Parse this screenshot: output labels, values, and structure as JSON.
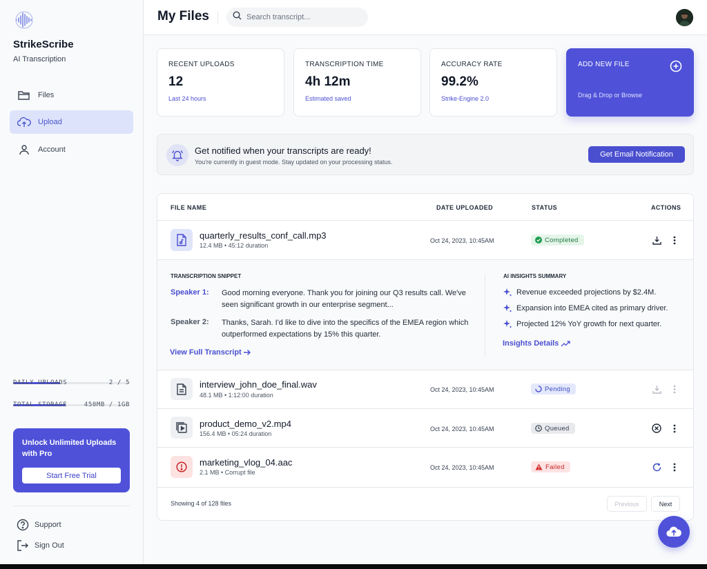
{
  "brand": {
    "name": "StrikeScribe",
    "tagline": "AI Transcription"
  },
  "nav": [
    {
      "label": "Files",
      "icon": "folder-icon",
      "active": false
    },
    {
      "label": "Upload",
      "icon": "cloud-upload-icon",
      "active": true
    },
    {
      "label": "Account",
      "icon": "user-icon",
      "active": false
    }
  ],
  "usage": {
    "daily_uploads": {
      "label": "DAILY UPLOADS",
      "value": "2 / 5",
      "fraction": 0.4
    },
    "total_storage": {
      "label": "TOTAL STORAGE",
      "value": "450MB / 1GB",
      "fraction": 0.45
    }
  },
  "promo": {
    "title": "Unlock Unlimited Uploads with Pro",
    "button": "Start Free Trial"
  },
  "footer_links": {
    "support": "Support",
    "signout": "Sign Out"
  },
  "header": {
    "title": "My Files",
    "search_placeholder": "Search transcript..."
  },
  "stats": [
    {
      "label": "RECENT UPLOADS",
      "value": "12",
      "sub": "Last 24 hours"
    },
    {
      "label": "TRANSCRIPTION TIME",
      "value": "4h 12m",
      "sub": "Estimated saved"
    },
    {
      "label": "ACCURACY RATE",
      "value": "99.2%",
      "sub": "Strike-Engine 2.0"
    }
  ],
  "add_file": {
    "label": "ADD NEW FILE",
    "sub": "Drag & Drop or Browse"
  },
  "notification": {
    "title": "Get notified when your transcripts are ready!",
    "subtitle": "You're currently in guest mode. Stay updated on your processing status.",
    "button": "Get Email Notification"
  },
  "table": {
    "columns": {
      "name": "FILE NAME",
      "date": "DATE UPLOADED",
      "status": "STATUS",
      "actions": "ACTIONS"
    },
    "rows": [
      {
        "name": "quarterly_results_conf_call.mp3",
        "meta": "12.4 MB • 45:12 duration",
        "date": "Oct 24, 2023, 10:45AM",
        "status": "Completed",
        "icon": "audio-file-icon",
        "status_color": "#1f7a3d"
      },
      {
        "name": "interview_john_doe_final.wav",
        "meta": "48.1 MB • 1:12:00 duration",
        "date": "Oct 24, 2023, 10:45AM",
        "status": "Pending",
        "icon": "document-icon",
        "status_color": "#3b4fc4"
      },
      {
        "name": "product_demo_v2.mp4",
        "meta": "156.4 MB • 05:24 duration",
        "date": "Oct 24, 2023, 10:45AM",
        "status": "Queued",
        "icon": "video-file-icon",
        "status_color": "#374151"
      },
      {
        "name": "marketing_vlog_04.aac",
        "meta": "2.1 MB • Corrupt file",
        "date": "Oct 24, 2023, 10:45AM",
        "status": "Failed",
        "icon": "error-icon",
        "status_color": "#c42727"
      }
    ],
    "expanded": {
      "snippet_title": "TRANSCRIPTION SNIPPET",
      "lines": [
        {
          "speaker": "Speaker 1:",
          "text": "Good morning everyone. Thank you for joining our Q3 results call. We've seen significant growth in our enterprise segment..."
        },
        {
          "speaker": "Speaker 2:",
          "text": "Thanks, Sarah. I'd like to dive into the specifics of the EMEA region which outperformed expectations by 15% this quarter."
        }
      ],
      "view_link": "View Full Transcript",
      "insights_title": "AI INSIGHTS SUMMARY",
      "insights": [
        "Revenue exceeded projections by $2.4M.",
        "Expansion into EMEA cited as primary driver.",
        "Projected 12% YoY growth for next quarter."
      ],
      "insights_link": "Insights Details"
    },
    "footer": {
      "showing": "Showing 4 of 128 files",
      "prev": "Previous",
      "next": "Next"
    }
  },
  "colors": {
    "accent": "#4f52d8",
    "accent_text": "#4a4fd0"
  }
}
